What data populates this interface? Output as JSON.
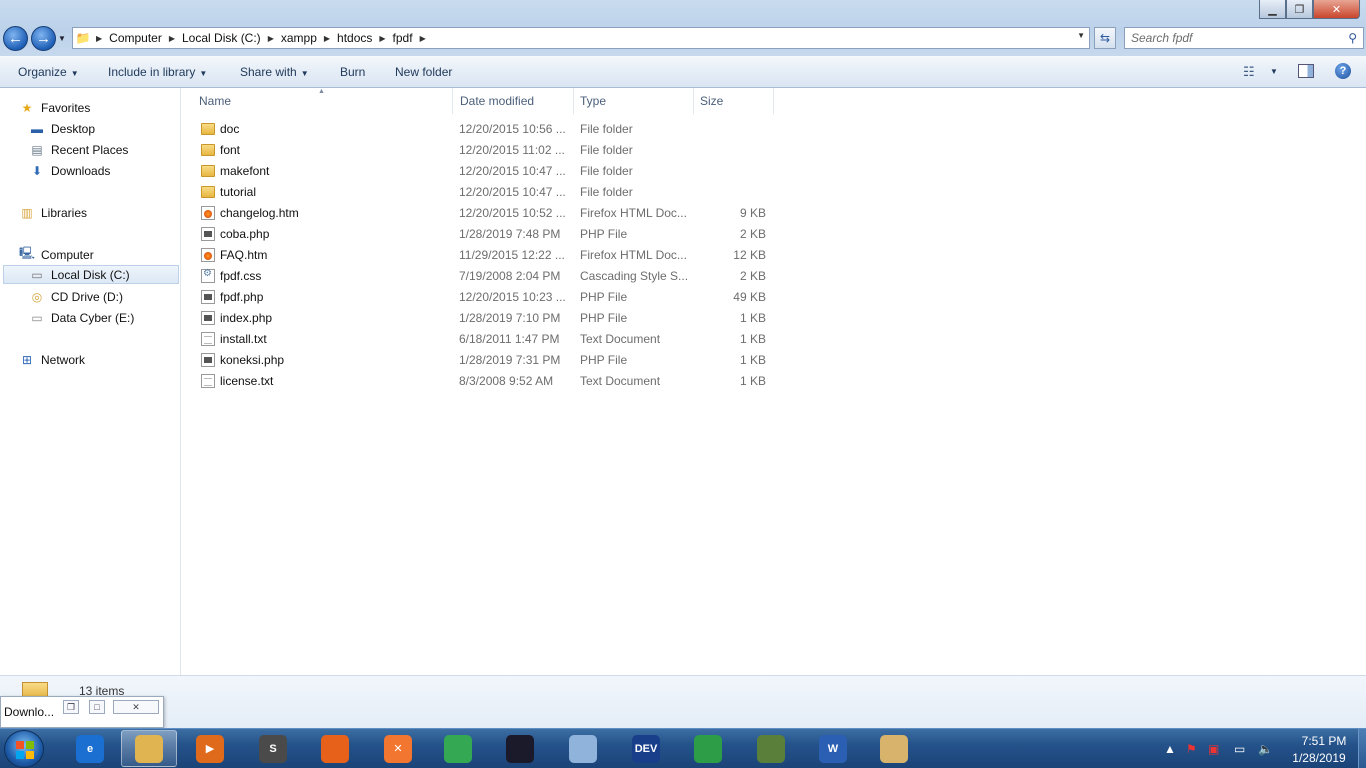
{
  "address": {
    "crumbs": [
      "Computer",
      "Local Disk (C:)",
      "xampp",
      "htdocs",
      "fpdf"
    ]
  },
  "search": {
    "placeholder": "Search fpdf"
  },
  "toolbar": {
    "organize": "Organize",
    "include_in_library": "Include in library",
    "share_with": "Share with",
    "burn": "Burn",
    "new_folder": "New folder"
  },
  "nav": {
    "favorites": "Favorites",
    "desktop": "Desktop",
    "recent_places": "Recent Places",
    "downloads": "Downloads",
    "libraries": "Libraries",
    "computer": "Computer",
    "local_disk": "Local Disk (C:)",
    "cd_drive": "CD Drive (D:)",
    "data_cyber": "Data Cyber (E:)",
    "network": "Network"
  },
  "columns": {
    "name": "Name",
    "date": "Date modified",
    "type": "Type",
    "size": "Size"
  },
  "files": [
    {
      "name": "doc",
      "date": "12/20/2015 10:56 ...",
      "type": "File folder",
      "size": "",
      "icon": "folder"
    },
    {
      "name": "font",
      "date": "12/20/2015 11:02 ...",
      "type": "File folder",
      "size": "",
      "icon": "folder"
    },
    {
      "name": "makefont",
      "date": "12/20/2015 10:47 ...",
      "type": "File folder",
      "size": "",
      "icon": "folder"
    },
    {
      "name": "tutorial",
      "date": "12/20/2015 10:47 ...",
      "type": "File folder",
      "size": "",
      "icon": "folder"
    },
    {
      "name": "changelog.htm",
      "date": "12/20/2015 10:52 ...",
      "type": "Firefox HTML Doc...",
      "size": "9 KB",
      "icon": "htm"
    },
    {
      "name": "coba.php",
      "date": "1/28/2019 7:48 PM",
      "type": "PHP File",
      "size": "2 KB",
      "icon": "php"
    },
    {
      "name": "FAQ.htm",
      "date": "11/29/2015 12:22 ...",
      "type": "Firefox HTML Doc...",
      "size": "12 KB",
      "icon": "htm"
    },
    {
      "name": "fpdf.css",
      "date": "7/19/2008 2:04 PM",
      "type": "Cascading Style S...",
      "size": "2 KB",
      "icon": "css"
    },
    {
      "name": "fpdf.php",
      "date": "12/20/2015 10:23 ...",
      "type": "PHP File",
      "size": "49 KB",
      "icon": "php"
    },
    {
      "name": "index.php",
      "date": "1/28/2019 7:10 PM",
      "type": "PHP File",
      "size": "1 KB",
      "icon": "php"
    },
    {
      "name": "install.txt",
      "date": "6/18/2011 1:47 PM",
      "type": "Text Document",
      "size": "1 KB",
      "icon": "txt"
    },
    {
      "name": "koneksi.php",
      "date": "1/28/2019 7:31 PM",
      "type": "PHP File",
      "size": "1 KB",
      "icon": "php"
    },
    {
      "name": "license.txt",
      "date": "8/3/2008 9:52 AM",
      "type": "Text Document",
      "size": "1 KB",
      "icon": "txt"
    }
  ],
  "details": {
    "item_count": "13 items"
  },
  "download_popup": {
    "title": "Downlo..."
  },
  "taskbar": {
    "apps": [
      {
        "name": "internet-explorer",
        "label": "e",
        "color": "#1b6fd1"
      },
      {
        "name": "windows-explorer",
        "label": "",
        "color": "#e0b450",
        "active": true
      },
      {
        "name": "media-player",
        "label": "▶",
        "color": "#e06a1c"
      },
      {
        "name": "sublime-text",
        "label": "S",
        "color": "#4a4a4a"
      },
      {
        "name": "firefox",
        "label": "",
        "color": "#e8611b"
      },
      {
        "name": "xampp",
        "label": "✕",
        "color": "#f27530"
      },
      {
        "name": "chrome",
        "label": "",
        "color": "#34a853"
      },
      {
        "name": "camera-app",
        "label": "",
        "color": "#1a1a2a"
      },
      {
        "name": "virtualbox",
        "label": "",
        "color": "#8fb3db"
      },
      {
        "name": "dev-cpp",
        "label": "DEV",
        "color": "#1a3f8a"
      },
      {
        "name": "internet-download-manager",
        "label": "",
        "color": "#2e9d47"
      },
      {
        "name": "satellite-tool",
        "label": "",
        "color": "#5a7f3a"
      },
      {
        "name": "word",
        "label": "W",
        "color": "#2b5fb4"
      },
      {
        "name": "paint",
        "label": "",
        "color": "#d7b36b"
      }
    ]
  },
  "clock": {
    "time": "7:51 PM",
    "date": "1/28/2019"
  }
}
